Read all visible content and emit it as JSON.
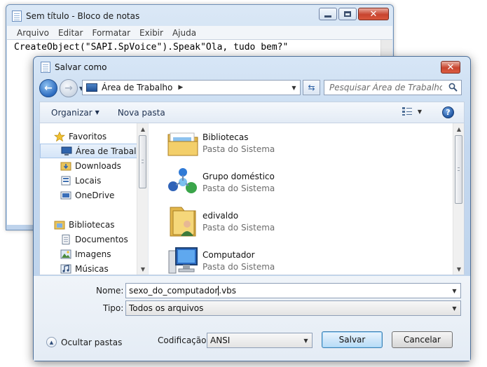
{
  "notepad": {
    "title": "Sem título - Bloco de notas",
    "menu": [
      "Arquivo",
      "Editar",
      "Formatar",
      "Exibir",
      "Ajuda"
    ],
    "content": "CreateObject(\"SAPI.SpVoice\").Speak\"Ola, tudo bem?\""
  },
  "dialog": {
    "title": "Salvar como",
    "address": {
      "location": "Área de Trabalho"
    },
    "search": {
      "placeholder": "Pesquisar Área de Trabalho"
    },
    "toolbar": {
      "organize": "Organizar",
      "new_folder": "Nova pasta"
    },
    "nav": {
      "favorites": "Favoritos",
      "favorite_items": [
        "Área de Trabalho",
        "Downloads",
        "Locais",
        "OneDrive"
      ],
      "libraries": "Bibliotecas",
      "library_items": [
        "Documentos",
        "Imagens",
        "Músicas"
      ]
    },
    "files": [
      {
        "name": "Bibliotecas",
        "type": "Pasta do Sistema",
        "icon": "libraries-icon"
      },
      {
        "name": "Grupo doméstico",
        "type": "Pasta do Sistema",
        "icon": "homegroup-icon"
      },
      {
        "name": "edivaldo",
        "type": "Pasta do Sistema",
        "icon": "user-folder-icon"
      },
      {
        "name": "Computador",
        "type": "Pasta do Sistema",
        "icon": "computer-icon"
      }
    ],
    "filename": {
      "label": "Nome:",
      "value_before_cursor": "sexo_do_computador",
      "value_after_cursor": ".vbs"
    },
    "filetype": {
      "label": "Tipo:",
      "value": "Todos os arquivos"
    },
    "encoding": {
      "label": "Codificação:",
      "value": "ANSI"
    },
    "hide_folders": "Ocultar pastas",
    "buttons": {
      "save": "Salvar",
      "cancel": "Cancelar"
    }
  },
  "colors": {
    "window_frame": "#c4d8ef",
    "selection": "#d4e5f8",
    "close_button": "#c8442f",
    "primary_button": "#cfe7fa"
  }
}
